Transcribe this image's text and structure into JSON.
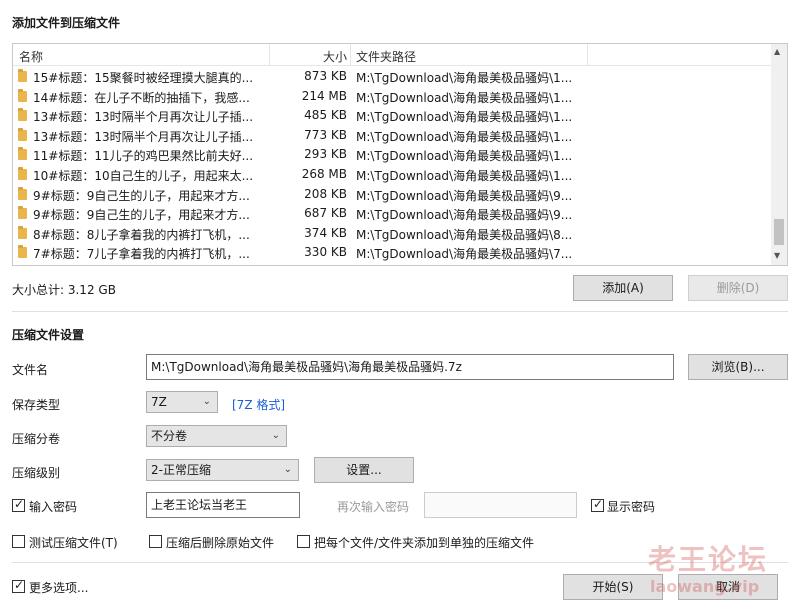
{
  "section1_title": "添加文件到压缩文件",
  "list": {
    "headers": {
      "name": "名称",
      "size": "大小",
      "path": "文件夹路径"
    },
    "rows": [
      {
        "name": "15#标题：15聚餐时被经理摸大腿真的...",
        "size": "873 KB",
        "path": "M:\\TgDownload\\海角最美极品骚妈\\1..."
      },
      {
        "name": "14#标题：在儿子不断的抽插下，我感...",
        "size": "214 MB",
        "path": "M:\\TgDownload\\海角最美极品骚妈\\1..."
      },
      {
        "name": "13#标题：13时隔半个月再次让儿子插...",
        "size": "485 KB",
        "path": "M:\\TgDownload\\海角最美极品骚妈\\1..."
      },
      {
        "name": "13#标题：13时隔半个月再次让儿子插...",
        "size": "773 KB",
        "path": "M:\\TgDownload\\海角最美极品骚妈\\1..."
      },
      {
        "name": "11#标题：11儿子的鸡巴果然比前夫好...",
        "size": "293 KB",
        "path": "M:\\TgDownload\\海角最美极品骚妈\\1..."
      },
      {
        "name": "10#标题：10自己生的儿子，用起来太...",
        "size": "268 MB",
        "path": "M:\\TgDownload\\海角最美极品骚妈\\1..."
      },
      {
        "name": "9#标题：9自己生的儿子，用起来才方...",
        "size": "208 KB",
        "path": "M:\\TgDownload\\海角最美极品骚妈\\9..."
      },
      {
        "name": "9#标题：9自己生的儿子，用起来才方...",
        "size": "687 KB",
        "path": "M:\\TgDownload\\海角最美极品骚妈\\9..."
      },
      {
        "name": "8#标题：8儿子拿着我的内裤打飞机，...",
        "size": "374 KB",
        "path": "M:\\TgDownload\\海角最美极品骚妈\\8..."
      },
      {
        "name": "7#标题：7儿子拿着我的内裤打飞机，...",
        "size": "330 KB",
        "path": "M:\\TgDownload\\海角最美极品骚妈\\7..."
      }
    ]
  },
  "total_size": "大小总计: 3.12 GB",
  "buttons": {
    "add": "添加(A)",
    "delete": "删除(D)",
    "browse": "浏览(B)...",
    "settings": "设置...",
    "start": "开始(S)",
    "cancel": "取消"
  },
  "section2_title": "压缩文件设置",
  "labels": {
    "filename": "文件名",
    "save_type": "保存类型",
    "split": "压缩分卷",
    "level": "压缩级别",
    "password": "输入密码",
    "reenter_password": "再次输入密码",
    "show_password": "显示密码",
    "test_archive": "测试压缩文件(T)",
    "delete_original": "压缩后删除原始文件",
    "each_separate": "把每个文件/文件夹添加到单独的压缩文件",
    "more_options": "更多选项..."
  },
  "values": {
    "filename": "M:\\TgDownload\\海角最美极品骚妈\\海角最美极品骚妈.7z",
    "save_type": "7Z",
    "format_link": "[7Z 格式]",
    "split": "不分卷",
    "level": "2-正常压缩",
    "password": "上老王论坛当老王",
    "reenter_password": ""
  },
  "checks": {
    "password": true,
    "show_password": true,
    "test_archive": false,
    "delete_original": false,
    "each_separate": false,
    "more_options": true
  },
  "watermark": {
    "line1": "老王论坛",
    "line2": "laowang.vip"
  }
}
